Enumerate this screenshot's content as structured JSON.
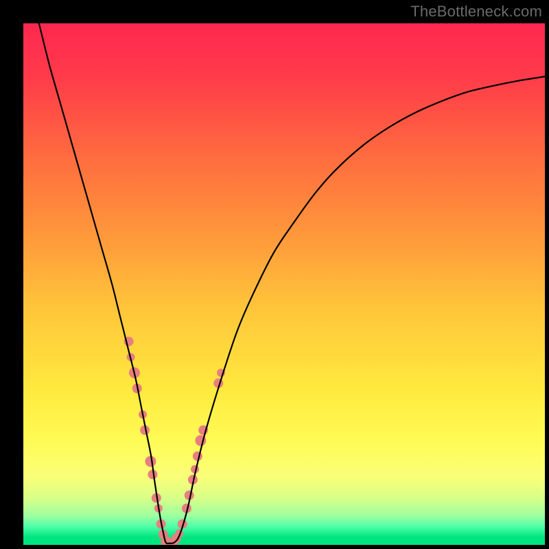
{
  "watermark": "TheBottleneck.com",
  "chart_data": {
    "type": "line",
    "title": "",
    "xlabel": "",
    "ylabel": "",
    "xlim": [
      0,
      100
    ],
    "ylim": [
      0,
      100
    ],
    "gradient_stops": [
      {
        "offset": 0.0,
        "color": "#ff2850"
      },
      {
        "offset": 0.1,
        "color": "#ff3a4a"
      },
      {
        "offset": 0.25,
        "color": "#ff6a3f"
      },
      {
        "offset": 0.4,
        "color": "#ff963b"
      },
      {
        "offset": 0.55,
        "color": "#ffc63a"
      },
      {
        "offset": 0.7,
        "color": "#ffe93e"
      },
      {
        "offset": 0.8,
        "color": "#fffb55"
      },
      {
        "offset": 0.87,
        "color": "#faff78"
      },
      {
        "offset": 0.91,
        "color": "#d9ff88"
      },
      {
        "offset": 0.945,
        "color": "#9dffa0"
      },
      {
        "offset": 0.965,
        "color": "#4effa9"
      },
      {
        "offset": 0.985,
        "color": "#00e57f"
      },
      {
        "offset": 1.0,
        "color": "#00e57f"
      }
    ],
    "series": [
      {
        "name": "bottleneck-curve",
        "x": [
          3,
          5,
          7,
          9,
          11,
          13,
          15,
          17,
          18.5,
          20,
          21.5,
          22.5,
          23.5,
          24.5,
          25.2,
          25.8,
          26.3,
          26.8,
          27.3,
          28,
          29,
          30,
          31.5,
          33,
          35,
          38,
          41,
          44,
          48,
          52,
          56,
          60,
          65,
          70,
          75,
          80,
          85,
          90,
          95,
          100
        ],
        "y": [
          100,
          92,
          85,
          78,
          71,
          64,
          57,
          50,
          44,
          38,
          32,
          27,
          22,
          17,
          12,
          8,
          5,
          2.5,
          0.5,
          0.3,
          0.5,
          2,
          7,
          14,
          22,
          32,
          41,
          48,
          56,
          62,
          67.5,
          72,
          76.5,
          80,
          82.8,
          85,
          86.8,
          88,
          89,
          89.8
        ]
      }
    ],
    "markers": {
      "name": "data-points",
      "color": "#e77f7f",
      "points": [
        {
          "x": 20.2,
          "y": 39,
          "r": 7
        },
        {
          "x": 20.6,
          "y": 36,
          "r": 6
        },
        {
          "x": 21.3,
          "y": 33,
          "r": 8
        },
        {
          "x": 21.8,
          "y": 30,
          "r": 7
        },
        {
          "x": 22.9,
          "y": 25,
          "r": 6
        },
        {
          "x": 23.3,
          "y": 22,
          "r": 7
        },
        {
          "x": 24.4,
          "y": 16,
          "r": 8
        },
        {
          "x": 24.8,
          "y": 13.5,
          "r": 7
        },
        {
          "x": 25.5,
          "y": 9,
          "r": 7
        },
        {
          "x": 25.9,
          "y": 7,
          "r": 6
        },
        {
          "x": 26.4,
          "y": 4,
          "r": 7
        },
        {
          "x": 26.8,
          "y": 2,
          "r": 7
        },
        {
          "x": 27.4,
          "y": 0.6,
          "r": 8
        },
        {
          "x": 28.0,
          "y": 0.3,
          "r": 7
        },
        {
          "x": 28.7,
          "y": 0.5,
          "r": 7
        },
        {
          "x": 29.3,
          "y": 1.2,
          "r": 7
        },
        {
          "x": 29.9,
          "y": 2.2,
          "r": 6
        },
        {
          "x": 30.5,
          "y": 4,
          "r": 7
        },
        {
          "x": 31.3,
          "y": 7,
          "r": 7
        },
        {
          "x": 31.8,
          "y": 9.5,
          "r": 7
        },
        {
          "x": 32.5,
          "y": 12.5,
          "r": 7
        },
        {
          "x": 32.9,
          "y": 14.5,
          "r": 6
        },
        {
          "x": 33.4,
          "y": 17,
          "r": 7
        },
        {
          "x": 34.0,
          "y": 20,
          "r": 8
        },
        {
          "x": 34.5,
          "y": 22,
          "r": 7
        },
        {
          "x": 37.4,
          "y": 31,
          "r": 7
        },
        {
          "x": 37.9,
          "y": 33,
          "r": 6
        }
      ]
    }
  }
}
